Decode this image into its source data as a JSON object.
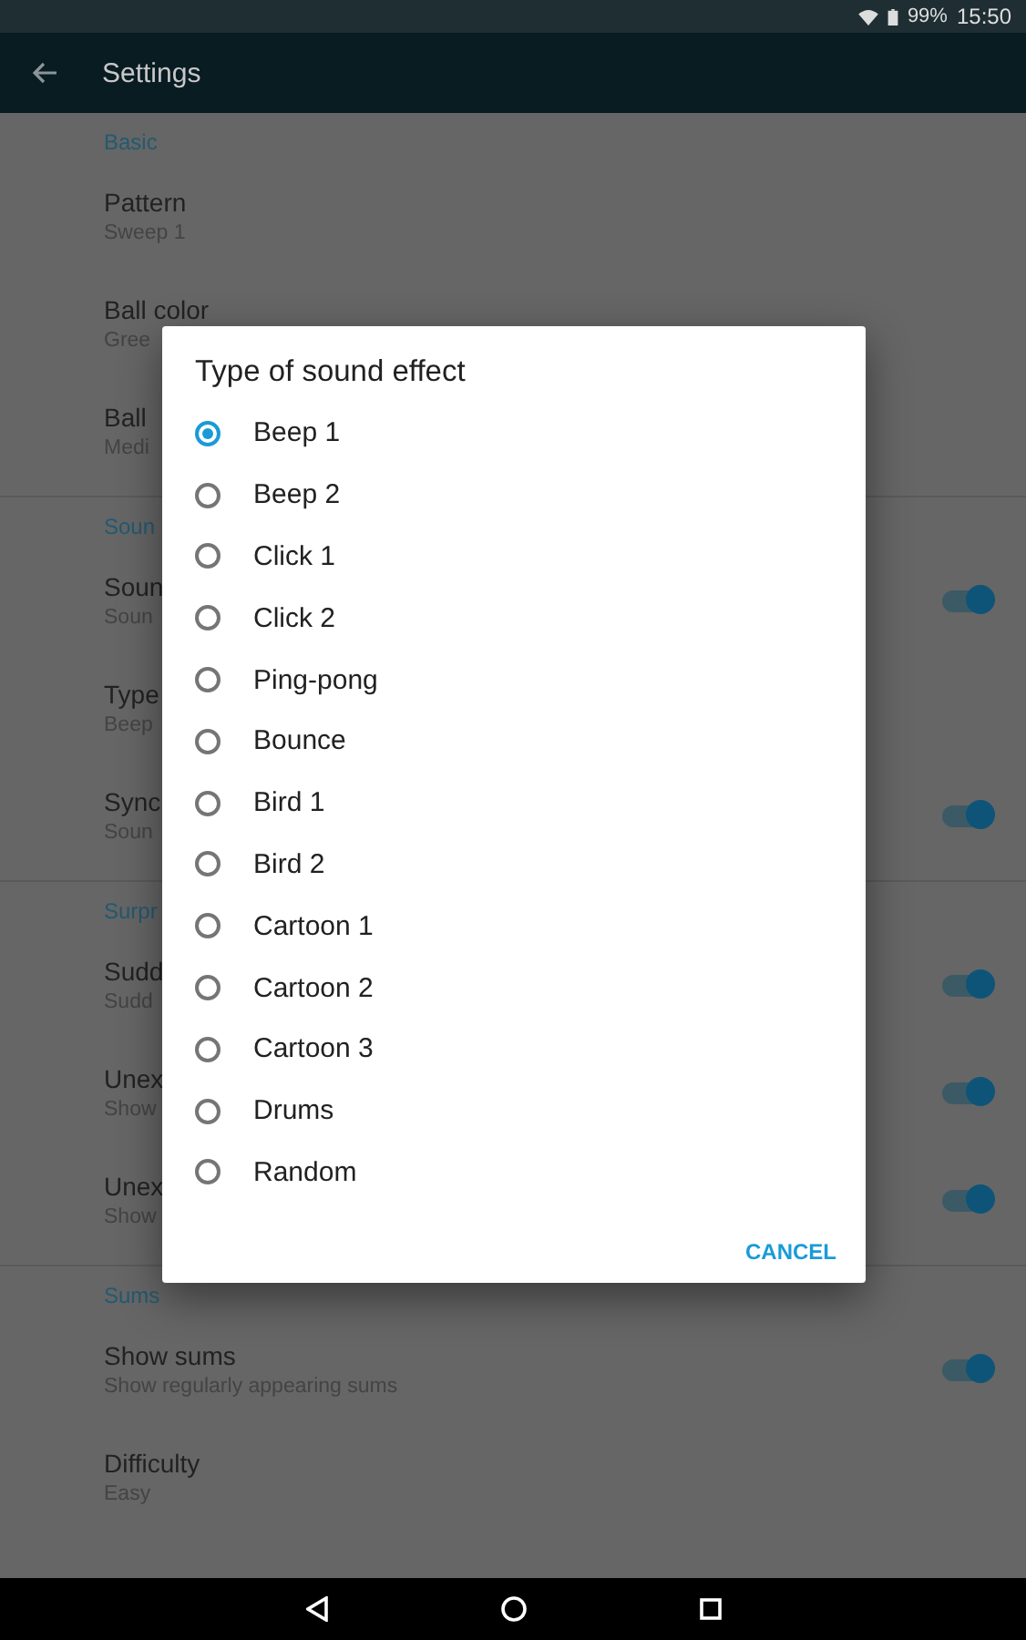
{
  "status_bar": {
    "battery": "99%",
    "time": "15:50"
  },
  "app_bar": {
    "title": "Settings"
  },
  "sections": [
    {
      "header": "Basic",
      "items": [
        {
          "title": "Pattern",
          "summary": "Sweep 1"
        },
        {
          "title": "Ball color",
          "summary": "Gree"
        },
        {
          "title": "Ball",
          "summary": "Medi"
        }
      ]
    },
    {
      "header": "Soun",
      "items": [
        {
          "title": "Soun",
          "summary": "Soun",
          "kind": "switch",
          "on": true
        },
        {
          "title": "Type",
          "summary": "Beep",
          "kind": "plain"
        },
        {
          "title": "Sync",
          "summary": "Soun",
          "kind": "switch",
          "on": true
        }
      ]
    },
    {
      "header": "Surpr",
      "items": [
        {
          "title": "Sudd",
          "summary": "Sudd",
          "kind": "switch",
          "on": true
        },
        {
          "title": "Unex",
          "summary": "Show",
          "kind": "switch",
          "on": true
        },
        {
          "title": "Unex",
          "summary": "Show",
          "kind": "switch",
          "on": true
        }
      ]
    },
    {
      "header": "Sums",
      "items": [
        {
          "title": "Show sums",
          "summary": "Show regularly appearing sums",
          "kind": "switch",
          "on": true
        },
        {
          "title": "Difficulty",
          "summary": "Easy",
          "kind": "plain"
        }
      ]
    }
  ],
  "dialog": {
    "title": "Type of sound effect",
    "options": [
      {
        "label": "Beep 1",
        "selected": true
      },
      {
        "label": "Beep 2",
        "selected": false
      },
      {
        "label": "Click 1",
        "selected": false
      },
      {
        "label": "Click 2",
        "selected": false
      },
      {
        "label": "Ping-pong",
        "selected": false
      },
      {
        "label": "Bounce",
        "selected": false
      },
      {
        "label": "Bird 1",
        "selected": false
      },
      {
        "label": "Bird 2",
        "selected": false
      },
      {
        "label": "Cartoon 1",
        "selected": false
      },
      {
        "label": "Cartoon 2",
        "selected": false
      },
      {
        "label": "Cartoon 3",
        "selected": false
      },
      {
        "label": "Drums",
        "selected": false
      },
      {
        "label": "Random",
        "selected": false
      }
    ],
    "button": "CANCEL"
  }
}
